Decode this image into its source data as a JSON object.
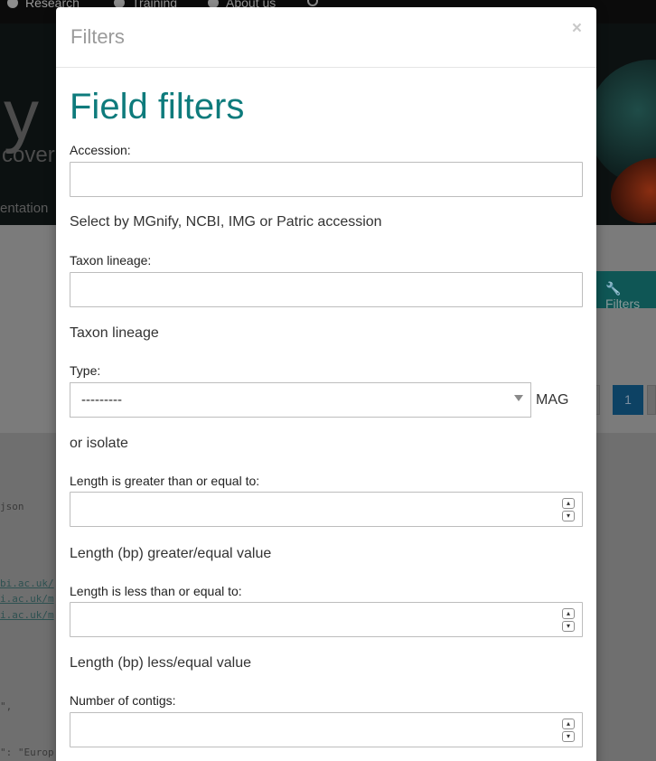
{
  "background": {
    "nav": [
      {
        "label": "Research",
        "icon": "network-icon"
      },
      {
        "label": "Training",
        "icon": "person-icon"
      },
      {
        "label": "About us",
        "icon": "info-icon"
      }
    ],
    "hero_title": "y",
    "hero_subtitle": "cover",
    "hero_tab": "entation",
    "filters_button": "Filters",
    "pagination_current": "1",
    "code_lines": {
      "json": "json",
      "link1": "bi.ac.uk/",
      "link2": "i.ac.uk/m",
      "link3": "i.ac.uk/m",
      "quote": "\",",
      "europe": "\": \"Europ"
    }
  },
  "modal": {
    "title": "Filters",
    "close_label": "×",
    "heading": "Field filters",
    "accession": {
      "label": "Accession:",
      "value": "",
      "help": "Select by MGnify, NCBI, IMG or Patric accession"
    },
    "taxon_lineage": {
      "label": "Taxon lineage:",
      "value": "",
      "help": "Taxon lineage"
    },
    "type": {
      "label": "Type:",
      "selected": "---------",
      "help_inline": "MAG",
      "help_wrap": "or isolate"
    },
    "length_gte": {
      "label": "Length is greater than or equal to:",
      "value": "",
      "help": "Length (bp) greater/equal value"
    },
    "length_lte": {
      "label": "Length is less than or equal to:",
      "value": "",
      "help": "Length (bp) less/equal value"
    },
    "num_contigs": {
      "label": "Number of contigs:",
      "value": ""
    }
  },
  "colors": {
    "accent": "#0e7b7c",
    "overlay": "#7a7a7a"
  }
}
